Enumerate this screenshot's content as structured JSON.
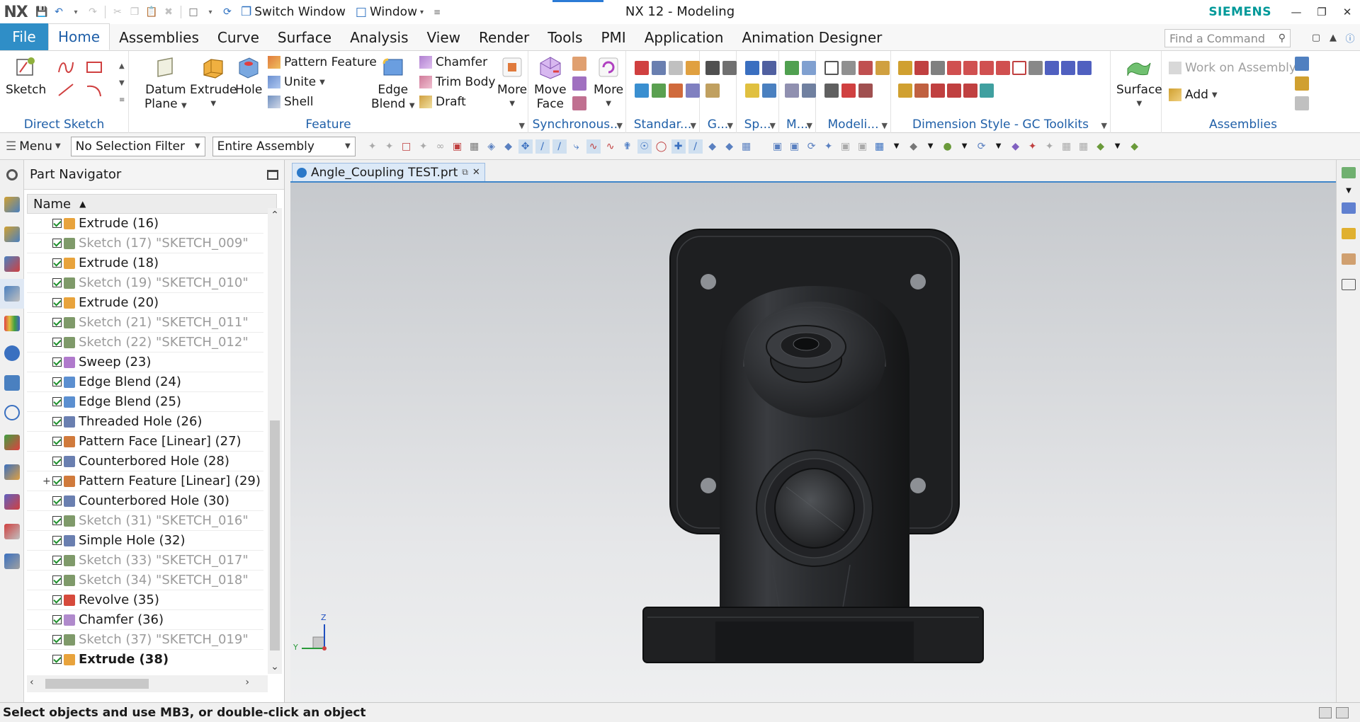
{
  "app": {
    "logo": "NX",
    "title": "NX 12 - Modeling",
    "brand": "SIEMENS",
    "switch_window": "Switch Window",
    "window_menu": "Window"
  },
  "tabs": [
    {
      "label": "File"
    },
    {
      "label": "Home"
    },
    {
      "label": "Assemblies"
    },
    {
      "label": "Curve"
    },
    {
      "label": "Surface"
    },
    {
      "label": "Analysis"
    },
    {
      "label": "View"
    },
    {
      "label": "Render"
    },
    {
      "label": "Tools"
    },
    {
      "label": "PMI"
    },
    {
      "label": "Application"
    },
    {
      "label": "Animation Designer"
    }
  ],
  "command_search": {
    "placeholder": "Find a Command"
  },
  "ribbon": {
    "direct_sketch": {
      "label": "Direct Sketch",
      "sketch": "Sketch"
    },
    "feature": {
      "label": "Feature",
      "datum_plane_1": "Datum",
      "datum_plane_2": "Plane",
      "extrude": "Extrude",
      "hole": "Hole",
      "pattern_feature": "Pattern Feature",
      "unite": "Unite",
      "shell": "Shell",
      "edge_blend_1": "Edge",
      "edge_blend_2": "Blend",
      "chamfer": "Chamfer",
      "trim_body": "Trim Body",
      "draft": "Draft",
      "more": "More"
    },
    "synchronous": {
      "label": "Synchronous...",
      "move_face_1": "Move",
      "move_face_2": "Face",
      "more": "More"
    },
    "standard": {
      "label": "Standar..."
    },
    "g": {
      "label": "G..."
    },
    "sp": {
      "label": "Sp..."
    },
    "m": {
      "label": "M..."
    },
    "modeling": {
      "label": "Modeli..."
    },
    "dimension_style": {
      "label": "Dimension Style - GC Toolkits"
    },
    "surface": {
      "label": "Surface"
    },
    "assemblies": {
      "label": "Assemblies",
      "work_on_assembly": "Work on Assembly",
      "add": "Add"
    }
  },
  "toolbar": {
    "menu": "Menu",
    "selection_filter": "No Selection Filter",
    "scope": "Entire Assembly"
  },
  "navigator": {
    "title": "Part Navigator",
    "column_name": "Name",
    "rows": [
      {
        "label": "Extrude (16)",
        "icon": "#e8a33c",
        "dim": false,
        "bold": false,
        "expander": ""
      },
      {
        "label": "Sketch (17) \"SKETCH_009\"",
        "icon": "#7f9a6a",
        "dim": true,
        "bold": false,
        "expander": ""
      },
      {
        "label": "Extrude (18)",
        "icon": "#e8a33c",
        "dim": false,
        "bold": false,
        "expander": ""
      },
      {
        "label": "Sketch (19) \"SKETCH_010\"",
        "icon": "#7f9a6a",
        "dim": true,
        "bold": false,
        "expander": ""
      },
      {
        "label": "Extrude (20)",
        "icon": "#e8a33c",
        "dim": false,
        "bold": false,
        "expander": ""
      },
      {
        "label": "Sketch (21) \"SKETCH_011\"",
        "icon": "#7f9a6a",
        "dim": true,
        "bold": false,
        "expander": ""
      },
      {
        "label": "Sketch (22) \"SKETCH_012\"",
        "icon": "#7f9a6a",
        "dim": true,
        "bold": false,
        "expander": ""
      },
      {
        "label": "Sweep (23)",
        "icon": "#b07acc",
        "dim": false,
        "bold": false,
        "expander": ""
      },
      {
        "label": "Edge Blend (24)",
        "icon": "#5b8fd0",
        "dim": false,
        "bold": false,
        "expander": ""
      },
      {
        "label": "Edge Blend (25)",
        "icon": "#5b8fd0",
        "dim": false,
        "bold": false,
        "expander": ""
      },
      {
        "label": "Threaded Hole (26)",
        "icon": "#6a7fb0",
        "dim": false,
        "bold": false,
        "expander": ""
      },
      {
        "label": "Pattern Face [Linear] (27)",
        "icon": "#d07a3c",
        "dim": false,
        "bold": false,
        "expander": ""
      },
      {
        "label": "Counterbored Hole (28)",
        "icon": "#6a7fb0",
        "dim": false,
        "bold": false,
        "expander": ""
      },
      {
        "label": "Pattern Feature [Linear] (29)",
        "icon": "#d07a3c",
        "dim": false,
        "bold": false,
        "expander": "+"
      },
      {
        "label": "Counterbored Hole (30)",
        "icon": "#6a7fb0",
        "dim": false,
        "bold": false,
        "expander": ""
      },
      {
        "label": "Sketch (31) \"SKETCH_016\"",
        "icon": "#7f9a6a",
        "dim": true,
        "bold": false,
        "expander": ""
      },
      {
        "label": "Simple Hole (32)",
        "icon": "#6a7fb0",
        "dim": false,
        "bold": false,
        "expander": ""
      },
      {
        "label": "Sketch (33) \"SKETCH_017\"",
        "icon": "#7f9a6a",
        "dim": true,
        "bold": false,
        "expander": ""
      },
      {
        "label": "Sketch (34) \"SKETCH_018\"",
        "icon": "#7f9a6a",
        "dim": true,
        "bold": false,
        "expander": ""
      },
      {
        "label": "Revolve (35)",
        "icon": "#d64a3c",
        "dim": false,
        "bold": false,
        "expander": ""
      },
      {
        "label": "Chamfer (36)",
        "icon": "#b08acc",
        "dim": false,
        "bold": false,
        "expander": ""
      },
      {
        "label": "Sketch (37) \"SKETCH_019\"",
        "icon": "#7f9a6a",
        "dim": true,
        "bold": false,
        "expander": ""
      },
      {
        "label": "Extrude (38)",
        "icon": "#e8a33c",
        "dim": false,
        "bold": true,
        "expander": ""
      }
    ]
  },
  "document": {
    "tab_label": "Angle_Coupling TEST.prt"
  },
  "triad": {
    "z": "Z",
    "y": "Y"
  },
  "status": {
    "prompt": "Select objects and use MB3, or double-click an object"
  },
  "colors": {
    "accent": "#2f8ec7",
    "active_tab_text": "#1f5fa8",
    "brand": "#009999",
    "part": "#2a2c2e"
  }
}
